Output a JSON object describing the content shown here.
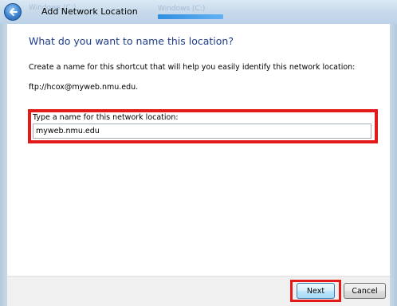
{
  "window": {
    "title": "Add Network Location"
  },
  "background": {
    "ghost_text_1": "Windows (C:)",
    "ghost_text_2": "File"
  },
  "wizard": {
    "heading": "What do you want to name this location?",
    "description": "Create a name for this shortcut that will help you easily identify this network location:",
    "location_url": "ftp://hcox@myweb.nmu.edu.",
    "field_label": "Type a name for this network location:",
    "field_value": "myweb.nmu.edu"
  },
  "footer": {
    "next_label": "Next",
    "cancel_label": "Cancel"
  },
  "colors": {
    "highlight": "#e21a1a",
    "heading": "#1e3c8a"
  },
  "icons": {
    "back": "back-arrow-icon"
  }
}
